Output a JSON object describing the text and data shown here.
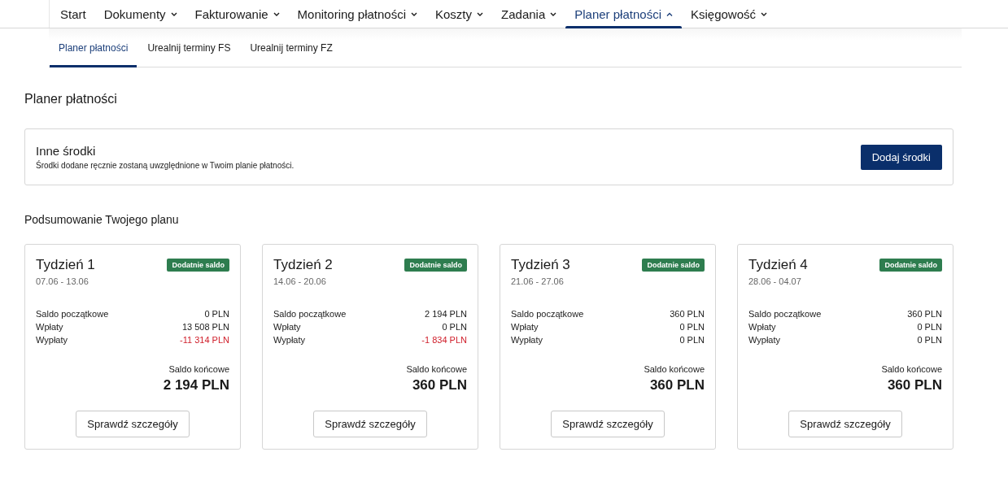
{
  "nav": [
    {
      "label": "Start",
      "dropdown": false,
      "selected": false
    },
    {
      "label": "Dokumenty",
      "dropdown": true,
      "expanded": false,
      "selected": false
    },
    {
      "label": "Fakturowanie",
      "dropdown": true,
      "expanded": false,
      "selected": false
    },
    {
      "label": "Monitoring płatności",
      "dropdown": true,
      "expanded": false,
      "selected": false
    },
    {
      "label": "Koszty",
      "dropdown": true,
      "expanded": false,
      "selected": false
    },
    {
      "label": "Zadania",
      "dropdown": true,
      "expanded": false,
      "selected": false
    },
    {
      "label": "Planer płatności",
      "dropdown": true,
      "expanded": true,
      "selected": true
    },
    {
      "label": "Księgowość",
      "dropdown": true,
      "expanded": false,
      "selected": false
    }
  ],
  "subtabs": [
    {
      "label": "Planer płatności",
      "selected": true
    },
    {
      "label": "Urealnij terminy FS",
      "selected": false
    },
    {
      "label": "Urealnij terminy FZ",
      "selected": false
    }
  ],
  "page_title": "Planer płatności",
  "funds": {
    "title": "Inne środki",
    "description": "Środki dodane ręcznie zostaną uwzględnione w Twoim planie płatności.",
    "button": "Dodaj środki"
  },
  "summary_title": "Podsumowanie Twojego planu",
  "weeks": [
    {
      "title": "Tydzień 1",
      "dates": "07.06 - 13.06",
      "badge": "Dodatnie saldo",
      "rows": [
        {
          "label": "Saldo początkowe",
          "value": "0 PLN",
          "negative": false
        },
        {
          "label": "Wpłaty",
          "value": "13 508 PLN",
          "negative": false
        },
        {
          "label": "Wypłaty",
          "value": "-11 314 PLN",
          "negative": true
        }
      ],
      "end_label": "Saldo końcowe",
      "end_value": "2 194 PLN",
      "button": "Sprawdź szczegóły"
    },
    {
      "title": "Tydzień 2",
      "dates": "14.06 - 20.06",
      "badge": "Dodatnie saldo",
      "rows": [
        {
          "label": "Saldo początkowe",
          "value": "2 194 PLN",
          "negative": false
        },
        {
          "label": "Wpłaty",
          "value": "0 PLN",
          "negative": false
        },
        {
          "label": "Wypłaty",
          "value": "-1 834 PLN",
          "negative": true
        }
      ],
      "end_label": "Saldo końcowe",
      "end_value": "360 PLN",
      "button": "Sprawdź szczegóły"
    },
    {
      "title": "Tydzień 3",
      "dates": "21.06 - 27.06",
      "badge": "Dodatnie saldo",
      "rows": [
        {
          "label": "Saldo początkowe",
          "value": "360 PLN",
          "negative": false
        },
        {
          "label": "Wpłaty",
          "value": "0 PLN",
          "negative": false
        },
        {
          "label": "Wypłaty",
          "value": "0 PLN",
          "negative": false
        }
      ],
      "end_label": "Saldo końcowe",
      "end_value": "360 PLN",
      "button": "Sprawdź szczegóły"
    },
    {
      "title": "Tydzień 4",
      "dates": "28.06 - 04.07",
      "badge": "Dodatnie saldo",
      "rows": [
        {
          "label": "Saldo początkowe",
          "value": "360 PLN",
          "negative": false
        },
        {
          "label": "Wpłaty",
          "value": "0 PLN",
          "negative": false
        },
        {
          "label": "Wypłaty",
          "value": "0 PLN",
          "negative": false
        }
      ],
      "end_label": "Saldo końcowe",
      "end_value": "360 PLN",
      "button": "Sprawdź szczegóły"
    }
  ]
}
